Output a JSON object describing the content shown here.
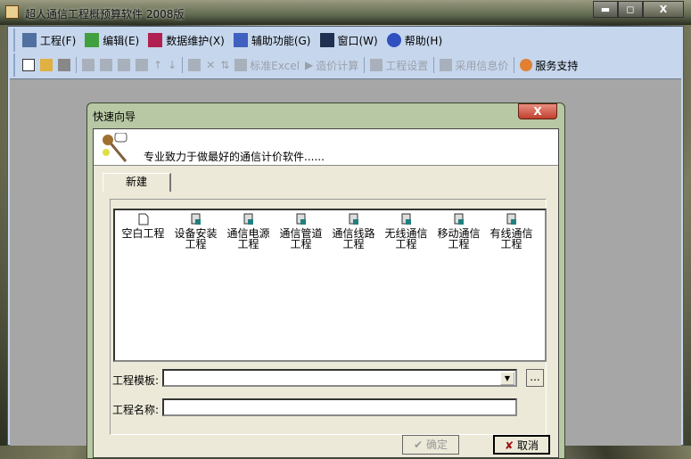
{
  "app": {
    "title": "超人通信工程概预算软件 2008版",
    "min": "▬",
    "max": "◻",
    "close": "X"
  },
  "menu": [
    {
      "label": "工程(F)",
      "icon": "project-icon"
    },
    {
      "label": "编辑(E)",
      "icon": "edit-icon"
    },
    {
      "label": "数据维护(X)",
      "icon": "data-maintenance-icon"
    },
    {
      "label": "辅助功能(G)",
      "icon": "utility-icon"
    },
    {
      "label": "窗口(W)",
      "icon": "window-icon"
    },
    {
      "label": "帮助(H)",
      "icon": "help-icon"
    }
  ],
  "toolbar": {
    "excel": "标准Excel",
    "calc": "造价计算",
    "settings": "工程设置",
    "price": "采用信息价",
    "support": "服务支持"
  },
  "dialog": {
    "title": "快速向导",
    "close": "X",
    "banner": "专业致力于做最好的通信计价软件......",
    "tab": "新建",
    "items": [
      {
        "l1": "空白工程",
        "l2": ""
      },
      {
        "l1": "设备安装",
        "l2": "工程"
      },
      {
        "l1": "通信电源",
        "l2": "工程"
      },
      {
        "l1": "通信管道",
        "l2": "工程"
      },
      {
        "l1": "通信线路",
        "l2": "工程"
      },
      {
        "l1": "无线通信",
        "l2": "工程"
      },
      {
        "l1": "移动通信",
        "l2": "工程"
      },
      {
        "l1": "有线通信",
        "l2": "工程"
      }
    ],
    "template_label": "工程模板:",
    "template_value": "",
    "browse": "...",
    "name_label": "工程名称:",
    "name_value": "",
    "ok": "确定",
    "cancel": "取消"
  }
}
